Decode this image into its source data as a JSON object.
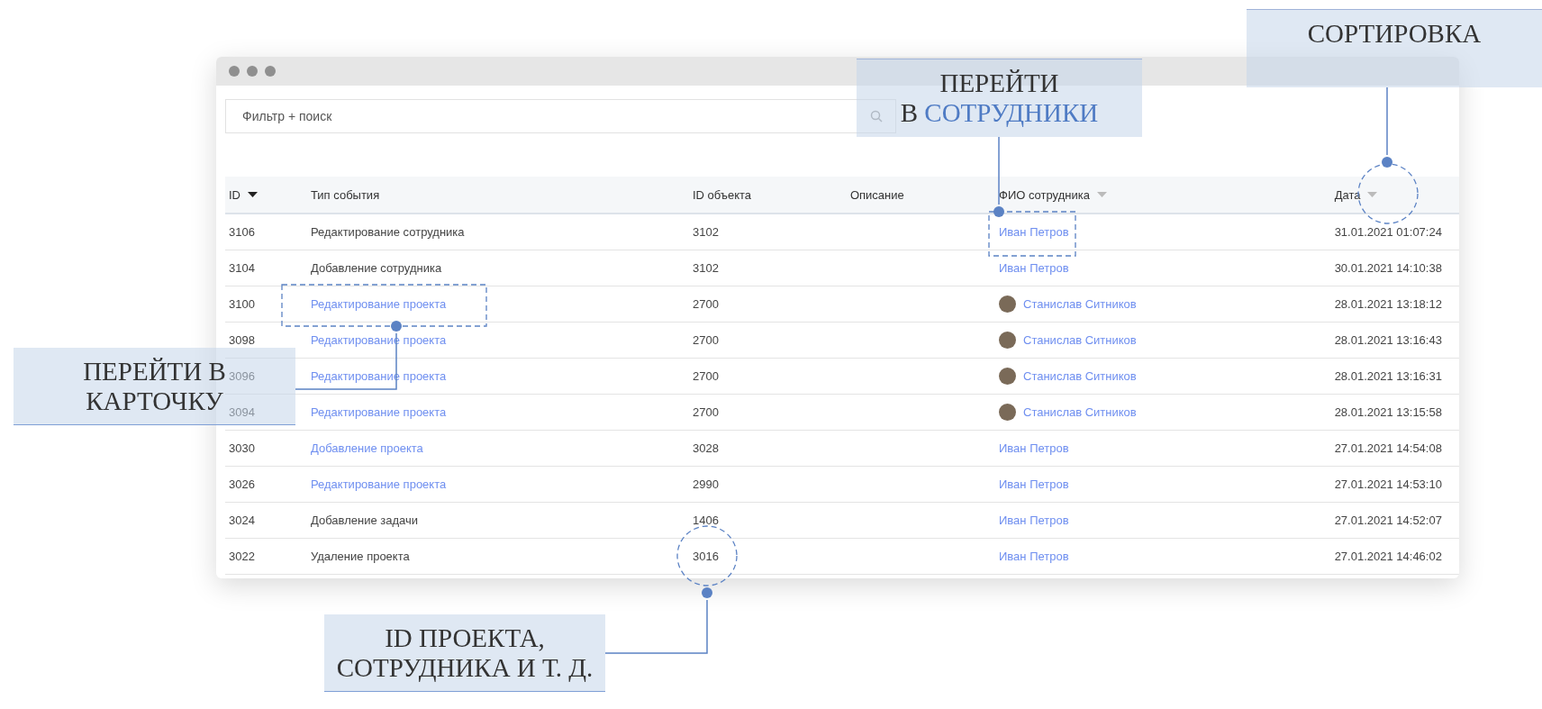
{
  "window": {
    "search": {
      "placeholder": "Фильтр + поиск"
    }
  },
  "table": {
    "columns": [
      {
        "label": "ID",
        "sortable": true,
        "sorted": true
      },
      {
        "label": "Тип события"
      },
      {
        "label": "ID объекта"
      },
      {
        "label": "Описание"
      },
      {
        "label": "ФИО сотрудника",
        "sortable": true,
        "sorted": false
      },
      {
        "label": "Дата",
        "sortable": true,
        "sorted": false
      }
    ],
    "rows": [
      {
        "id": "3106",
        "event": "Редактирование сотрудника",
        "event_link": false,
        "object_id": "3102",
        "employee": "Иван Петров",
        "avatar": false,
        "date": "31.01.2021 01:07:24"
      },
      {
        "id": "3104",
        "event": "Добавление сотрудника",
        "event_link": false,
        "object_id": "3102",
        "employee": "Иван Петров",
        "avatar": false,
        "date": "30.01.2021 14:10:38"
      },
      {
        "id": "3100",
        "event": "Редактирование проекта",
        "event_link": true,
        "object_id": "2700",
        "employee": "Станислав Ситников",
        "avatar": true,
        "date": "28.01.2021 13:18:12"
      },
      {
        "id": "3098",
        "event": "Редактирование проекта",
        "event_link": true,
        "object_id": "2700",
        "employee": "Станислав Ситников",
        "avatar": true,
        "date": "28.01.2021 13:16:43"
      },
      {
        "id": "3096",
        "event": "Редактирование проекта",
        "event_link": true,
        "object_id": "2700",
        "employee": "Станислав Ситников",
        "avatar": true,
        "date": "28.01.2021 13:16:31"
      },
      {
        "id": "3094",
        "event": "Редактирование проекта",
        "event_link": true,
        "object_id": "2700",
        "employee": "Станислав Ситников",
        "avatar": true,
        "date": "28.01.2021 13:15:58"
      },
      {
        "id": "3030",
        "event": "Добавление проекта",
        "event_link": true,
        "object_id": "3028",
        "employee": "Иван Петров",
        "avatar": false,
        "date": "27.01.2021 14:54:08"
      },
      {
        "id": "3026",
        "event": "Редактирование проекта",
        "event_link": true,
        "object_id": "2990",
        "employee": "Иван Петров",
        "avatar": false,
        "date": "27.01.2021 14:53:10"
      },
      {
        "id": "3024",
        "event": "Добавление задачи",
        "event_link": false,
        "object_id": "1406",
        "employee": "Иван Петров",
        "avatar": false,
        "date": "27.01.2021 14:52:07"
      },
      {
        "id": "3022",
        "event": "Удаление проекта",
        "event_link": false,
        "object_id": "3016",
        "employee": "Иван Петров",
        "avatar": false,
        "date": "27.01.2021 14:46:02"
      }
    ]
  },
  "annotations": [
    {
      "lines": [
        "СОРТИРОВКА"
      ],
      "kind": "circle"
    },
    {
      "lines": [
        "ПЕРЕЙТИ",
        "В "
      ],
      "highlight": "СОТРУДНИКИ",
      "kind": "frame"
    },
    {
      "lines": [
        "ПЕРЕЙТИ В",
        "КАРТОЧКУ"
      ],
      "kind": "frame"
    },
    {
      "lines": [
        "ID ПРОЕКТА,",
        "СОТРУДНИКА И Т. Д."
      ],
      "kind": "circle"
    }
  ]
}
